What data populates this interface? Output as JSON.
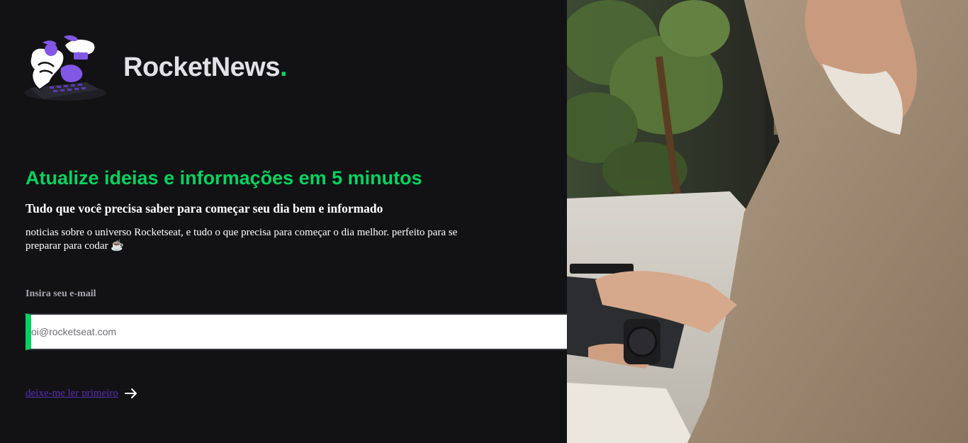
{
  "brand": {
    "name": "RocketNews",
    "dot": ".",
    "accent": "#04d361"
  },
  "hero": {
    "headline": "Atualize ideias e informações em 5 minutos",
    "subheadline": "Tudo que você precisa saber para começar seu dia bem e informado",
    "description": "noticias sobre o universo Rocketseat, e tudo o que precisa para começar o dia melhor. perfeito para se preparar para codar ☕"
  },
  "form": {
    "email_label": "Insira seu e-mail",
    "email_placeholder": "oi@rocketseat.com",
    "email_value": "",
    "send_icon": "send-icon"
  },
  "link": {
    "label": "deixe-me ler primeiro",
    "icon": "arrow-right-icon"
  },
  "colors": {
    "background": "#121214",
    "green": "#04d361",
    "purple": "#8257e5",
    "text": "#ffffff",
    "muted": "#a8a8b3"
  }
}
